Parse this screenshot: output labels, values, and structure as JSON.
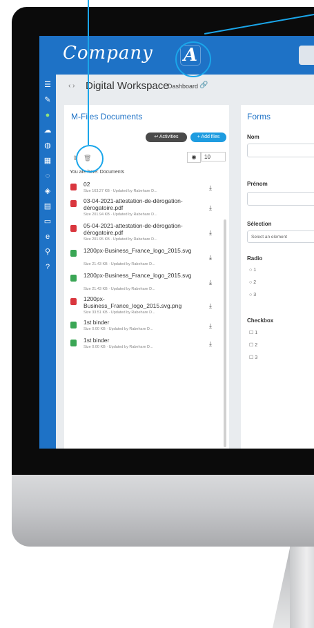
{
  "header": {
    "logo_text": "Company",
    "logo_badge": "A"
  },
  "sidebar": {
    "icons": [
      "menu-icon",
      "pencil-icon",
      "status-dot-icon",
      "cloud-icon",
      "globe-icon",
      "grid-icon",
      "chat-icon",
      "shield-icon",
      "sticky-note-icon",
      "browser-icon",
      "edge-icon",
      "search-icon",
      "help-icon"
    ]
  },
  "breadcrumb": {
    "arrows": "‹ ›",
    "title": "Digital Workspace",
    "subtitle": "Dashboard",
    "link_icon": "link-icon"
  },
  "documents": {
    "title": "M-Files Documents",
    "activities_label": "↩ Activities",
    "add_files_label": "+ Add files",
    "view_toggle": "◉",
    "page_size": "10",
    "path_label": "You are here: Documents",
    "files": [
      {
        "name": "02",
        "meta": "Size 163.27 KB · Updated by Rabehare D...",
        "color": "#d9363e"
      },
      {
        "name": "03-04-2021-attestation-de-dérogation-dérogatoire.pdf",
        "meta": "Size 201.94 KB · Updated by Rabehare D...",
        "color": "#d9363e"
      },
      {
        "name": "05-04-2021-attestation-de-dérogation-dérogatoire.pdf",
        "meta": "Size 201.95 KB · Updated by Rabehare D...",
        "color": "#d9363e"
      },
      {
        "name": "1200px-Business_France_logo_2015.svg",
        "meta": "Size 21.43 KB · Updated by Rabehare D...",
        "color": "#3aa655"
      },
      {
        "name": "1200px-Business_France_logo_2015.svg",
        "meta": "Size 21.43 KB · Updated by Rabehare D...",
        "color": "#3aa655"
      },
      {
        "name": "1200px-Business_France_logo_2015.svg.png",
        "meta": "Size 33.51 KB · Updated by Rabehare D...",
        "color": "#d9363e"
      },
      {
        "name": "1st binder",
        "meta": "Size 0.00 KB · Updated by Rabehare D...",
        "color": "#3aa655"
      },
      {
        "name": "1st binder",
        "meta": "Size 0.00 KB · Updated by Rabehare D...",
        "color": "#3aa655"
      }
    ]
  },
  "forms": {
    "title": "Forms",
    "nom_label": "Nom",
    "prenom_label": "Prénom",
    "selection_label": "Sélection",
    "selection_placeholder": "Select an element",
    "radio_label": "Radio",
    "radio_options": [
      "1",
      "2",
      "3"
    ],
    "checkbox_label": "Checkbox",
    "checkbox_options": [
      "1",
      "2",
      "3"
    ]
  },
  "colors": {
    "brand_blue": "#1e72c6",
    "callout_blue": "#1aa6ea",
    "pdf_red": "#d9363e",
    "image_green": "#3aa655"
  }
}
